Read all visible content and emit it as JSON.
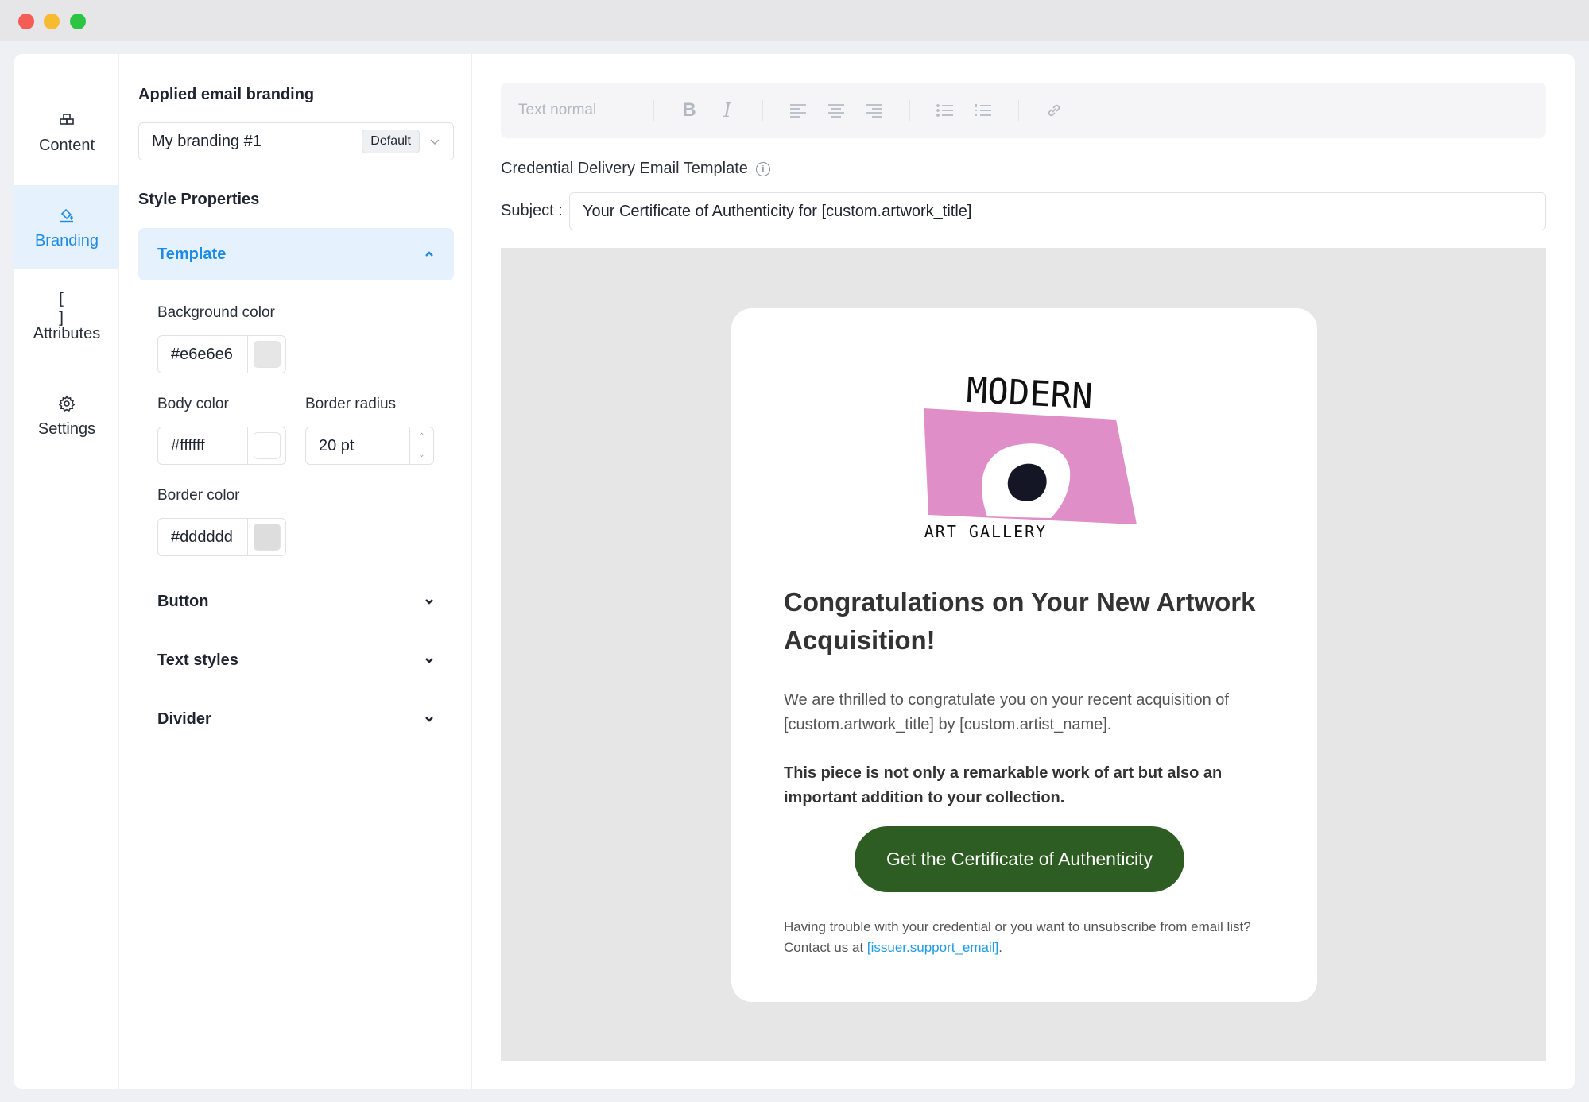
{
  "nav": {
    "items": [
      {
        "label": "Content",
        "icon": "content-blocks-icon"
      },
      {
        "label": "Branding",
        "icon": "paint-bucket-icon",
        "active": true
      },
      {
        "label": "Attributes",
        "icon": "brackets-icon",
        "glyph": "[ ]"
      },
      {
        "label": "Settings",
        "icon": "gear-icon"
      }
    ]
  },
  "panel": {
    "applied_branding_label": "Applied email branding",
    "branding_value": "My branding #1",
    "branding_badge": "Default",
    "style_properties_label": "Style Properties",
    "template": {
      "title": "Template",
      "background_color_label": "Background color",
      "background_color": "#e6e6e6",
      "body_color_label": "Body color",
      "body_color": "#ffffff",
      "border_radius_label": "Border radius",
      "border_radius": "20 pt",
      "border_color_label": "Border color",
      "border_color": "#dddddd"
    },
    "sections": [
      {
        "title": "Button"
      },
      {
        "title": "Text styles"
      },
      {
        "title": "Divider"
      }
    ]
  },
  "editor": {
    "toolbar": {
      "text_style": "Text normal",
      "bold": "B",
      "italic": "I"
    },
    "template_title": "Credential Delivery Email Template",
    "info_glyph": "i",
    "subject_label": "Subject :",
    "subject_value": "Your Certificate of Authenticity for [custom.artwork_title]"
  },
  "email": {
    "logo_top": "MODERN",
    "logo_bottom": "ART GALLERY",
    "heading": "Congratulations on Your New Artwork Acquisition!",
    "paragraph1": "We are thrilled to congratulate you on your recent acquisition of [custom.artwork_title] by [custom.artist_name].",
    "paragraph2": "This piece is not only a remarkable work of art but also an important addition to your collection.",
    "cta_label": "Get the Certificate of Authenticity",
    "footer_text": "Having trouble with your credential or you want to unsubscribe from email list? Contact us at ",
    "footer_link": "[issuer.support_email]",
    "footer_end": "."
  },
  "colors": {
    "accent": "#1e8be6",
    "accent_bg": "#e5f1fc",
    "cta": "#2d5d22",
    "logo_pink": "#e08ec8",
    "link": "#1e9be6"
  }
}
